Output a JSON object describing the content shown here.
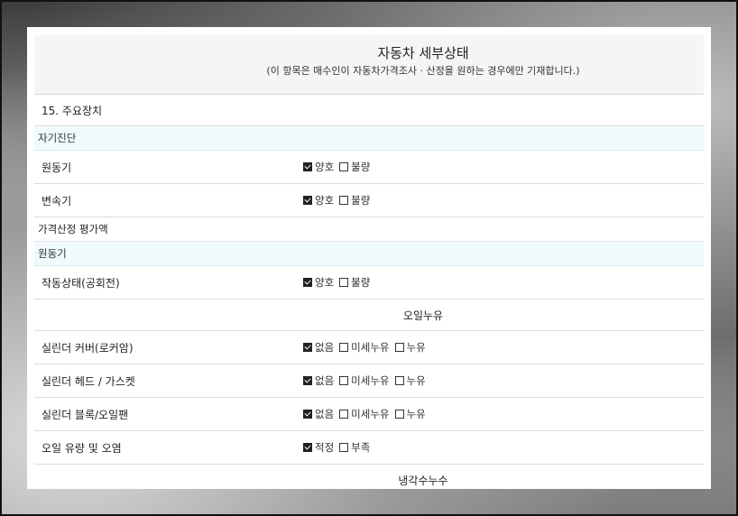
{
  "header": {
    "title": "자동차 세부상태",
    "subtitle": "(이 항목은 매수인이 자동차가격조사 · 산정을 원하는 경우에만 기재합니다.)"
  },
  "section_main": "15. 주요장치",
  "self_diagnosis": {
    "label": "자기진단",
    "rows": [
      {
        "label": "원동기",
        "options": [
          {
            "text": "양호",
            "checked": true
          },
          {
            "text": "불량",
            "checked": false
          }
        ]
      },
      {
        "label": "변속기",
        "options": [
          {
            "text": "양호",
            "checked": true
          },
          {
            "text": "불량",
            "checked": false
          }
        ]
      }
    ]
  },
  "valuation": {
    "label": "가격산정 평가액",
    "engine_label": "원동기",
    "operation": {
      "label": "작동상태(공회전)",
      "options": [
        {
          "text": "양호",
          "checked": true
        },
        {
          "text": "불량",
          "checked": false
        }
      ]
    },
    "oil_leak_header": "오일누유",
    "oil_rows": [
      {
        "label": "실린더 커버(로커암)",
        "options": [
          {
            "text": "없음",
            "checked": true
          },
          {
            "text": "미세누유",
            "checked": false
          },
          {
            "text": "누유",
            "checked": false
          }
        ]
      },
      {
        "label": "실린더 헤드 / 가스켓",
        "options": [
          {
            "text": "없음",
            "checked": true
          },
          {
            "text": "미세누유",
            "checked": false
          },
          {
            "text": "누유",
            "checked": false
          }
        ]
      },
      {
        "label": "실린더 블록/오일팬",
        "options": [
          {
            "text": "없음",
            "checked": true
          },
          {
            "text": "미세누유",
            "checked": false
          },
          {
            "text": "누유",
            "checked": false
          }
        ]
      },
      {
        "label": "오일 유량 및 오염",
        "options": [
          {
            "text": "적정",
            "checked": true
          },
          {
            "text": "부족",
            "checked": false
          }
        ]
      }
    ],
    "coolant_header": "냉각수누수"
  }
}
